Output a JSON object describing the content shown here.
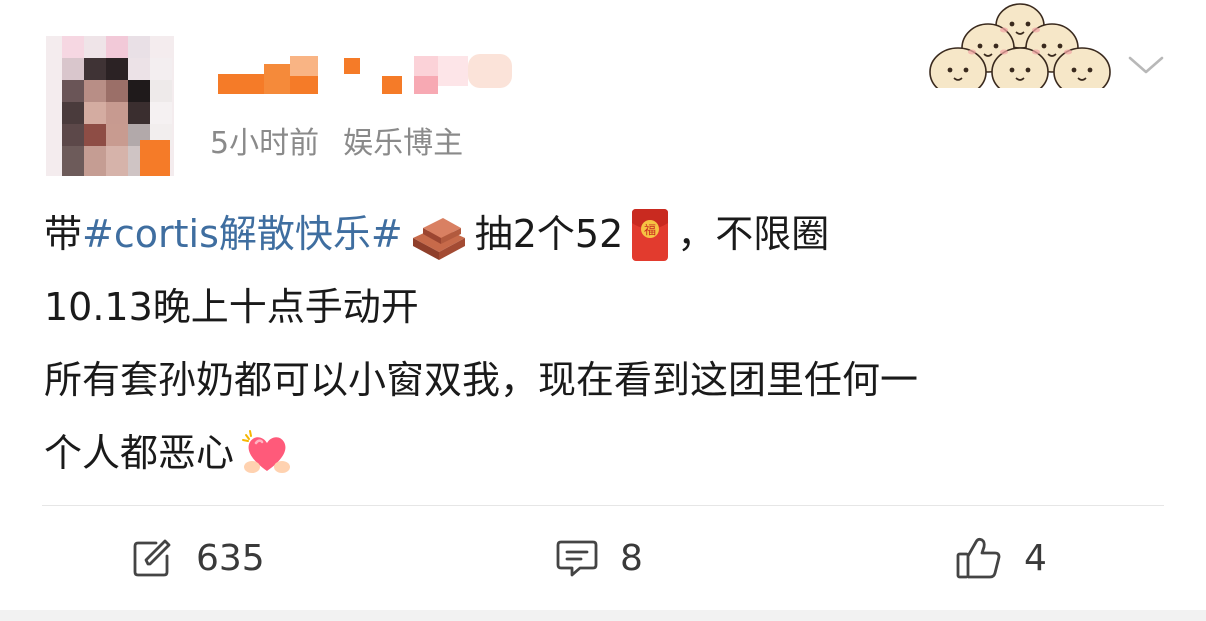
{
  "author": {
    "time": "5小时前",
    "label": "娱乐博主"
  },
  "post": {
    "line1": {
      "prefix": "带",
      "topic": "#cortis解散快乐#",
      "after_brick": "抽2个52",
      "after_packet": "，不限圈"
    },
    "line2": "10.13晚上十点手动开",
    "line3": "所有套孙奶都可以小窗双我，现在看到这团里任何一",
    "line4": "个人都恶心",
    "emoji": {
      "brick": "brick-emoji",
      "red_packet": "red-packet-emoji",
      "heart": "heart-hands-emoji"
    }
  },
  "actions": {
    "repost_count": "635",
    "comment_count": "8",
    "like_count": "4"
  },
  "colors": {
    "topic": "#3f6ea0",
    "meta": "#8a8a8a",
    "text": "#1a1a1a",
    "avatar_orange": "#f57b28"
  }
}
